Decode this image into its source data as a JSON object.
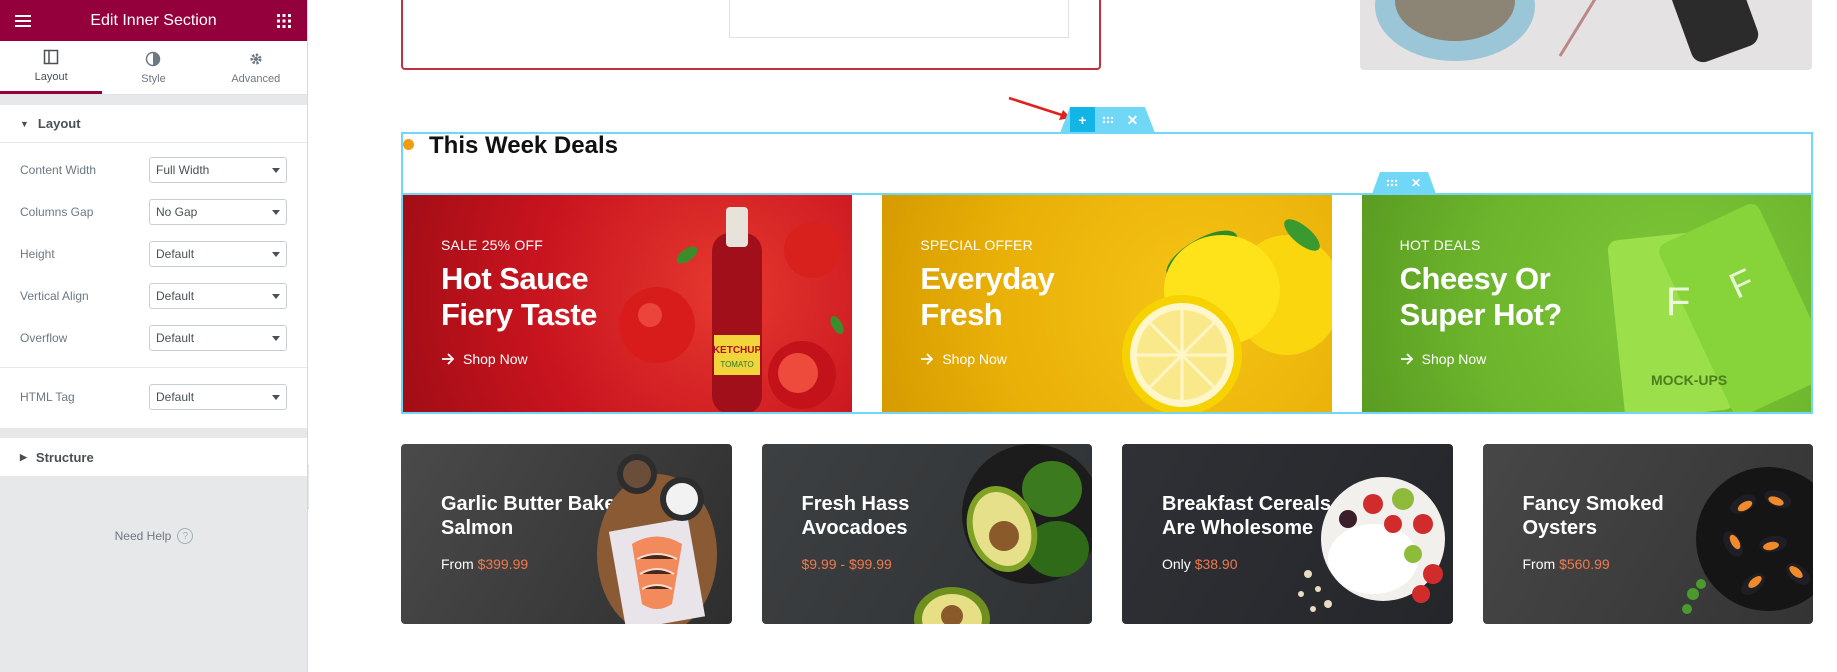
{
  "panel": {
    "title": "Edit Inner Section",
    "tabs": [
      {
        "label": "Layout",
        "icon": "layout-icon"
      },
      {
        "label": "Style",
        "icon": "contrast-icon"
      },
      {
        "label": "Advanced",
        "icon": "gear-icon"
      }
    ],
    "layout_section": {
      "title": "Layout",
      "controls": [
        {
          "label": "Content Width",
          "value": "Full Width"
        },
        {
          "label": "Columns Gap",
          "value": "No Gap"
        },
        {
          "label": "Height",
          "value": "Default"
        },
        {
          "label": "Vertical Align",
          "value": "Default"
        },
        {
          "label": "Overflow",
          "value": "Default"
        }
      ],
      "html_tag": {
        "label": "HTML Tag",
        "value": "Default"
      }
    },
    "structure_section": {
      "title": "Structure"
    },
    "need_help": "Need Help",
    "help_glyph": "?"
  },
  "preview": {
    "section_title": "This Week Deals",
    "banners": [
      {
        "kicker": "SALE 25% OFF",
        "title": "Hot Sauce Fiery Taste",
        "cta": "Shop Now",
        "color": "#c9141f"
      },
      {
        "kicker": "SPECIAL OFFER",
        "title": "Everyday Fresh",
        "cta": "Shop Now",
        "color": "#e9b008"
      },
      {
        "kicker": "HOT DEALS",
        "title": "Cheesy Or Super Hot?",
        "cta": "Shop Now",
        "color": "#6cb52c"
      }
    ],
    "products": [
      {
        "title": "Garlic Butter Baked Salmon",
        "prefix": "From",
        "price": "$399.99"
      },
      {
        "title": "Fresh Hass Avocadoes",
        "prefix": "",
        "price": "$9.99 - $99.99"
      },
      {
        "title": "Breakfast Cereals Are Wholesome",
        "prefix": "Only",
        "price": "$38.90"
      },
      {
        "title": "Fancy Smoked Oysters",
        "prefix": "From",
        "price": "$560.99"
      }
    ],
    "accent_color": "#93003c",
    "price_color": "#f07a4d",
    "editor_outline_color": "#71d7f7",
    "bottle_label": "KETCHUP",
    "bottle_sublabel": "TOMATO",
    "pack_lettering": "MOCK-UPS"
  }
}
